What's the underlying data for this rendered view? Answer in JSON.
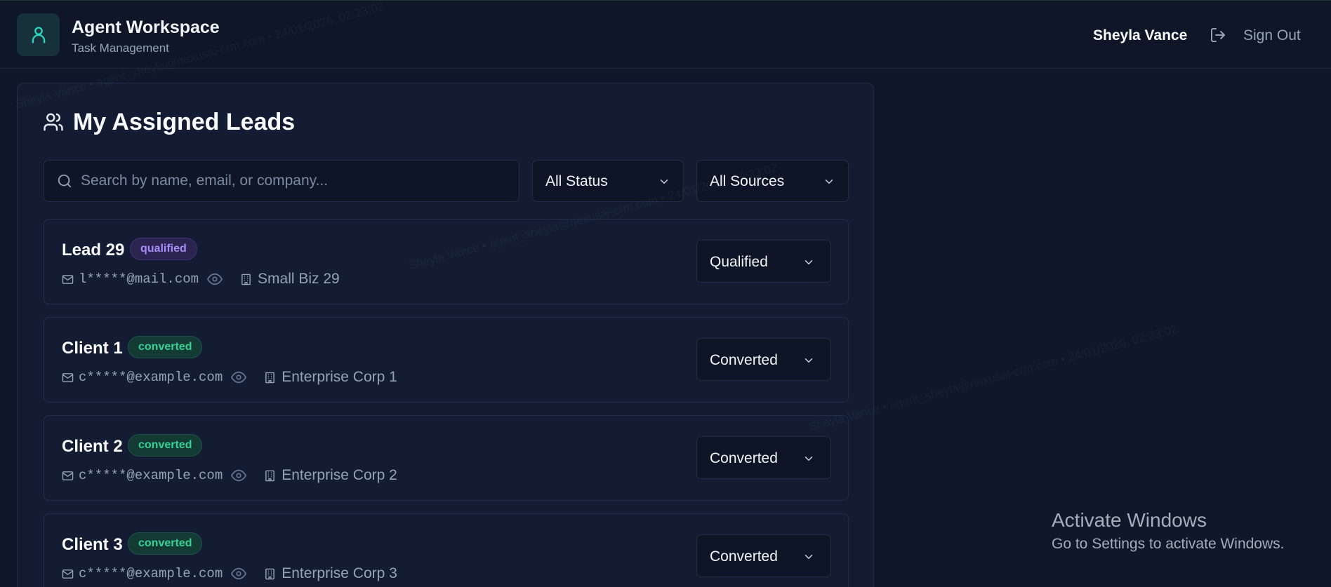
{
  "header": {
    "app_title": "Agent Workspace",
    "app_subtitle": "Task Management",
    "user_name": "Sheyla Vance",
    "signout_label": "Sign Out"
  },
  "panel": {
    "title": "My Assigned Leads",
    "search_placeholder": "Search by name, email, or company...",
    "status_filter": "All Status",
    "source_filter": "All Sources"
  },
  "leads": [
    {
      "name": "Lead 29",
      "badge": "qualified",
      "email": "l*****@mail.com",
      "company": "Small Biz 29",
      "status": "Qualified"
    },
    {
      "name": "Client 1",
      "badge": "converted",
      "email": "c*****@example.com",
      "company": "Enterprise Corp 1",
      "status": "Converted"
    },
    {
      "name": "Client 2",
      "badge": "converted",
      "email": "c*****@example.com",
      "company": "Enterprise Corp 2",
      "status": "Converted"
    },
    {
      "name": "Client 3",
      "badge": "converted",
      "email": "c*****@example.com",
      "company": "Enterprise Corp 3",
      "status": "Converted"
    }
  ],
  "watermark": "Sheyla Vance • agent_sheyla@nexusai-crm.com • 24/01/2026, 02:23:02",
  "windows_activation": {
    "title": "Activate Windows",
    "subtitle": "Go to Settings to activate Windows."
  },
  "colors": {
    "background": "#0f172a",
    "accent": "#2dd4bf",
    "qualified": "#a78bfa",
    "converted": "#34d399"
  }
}
